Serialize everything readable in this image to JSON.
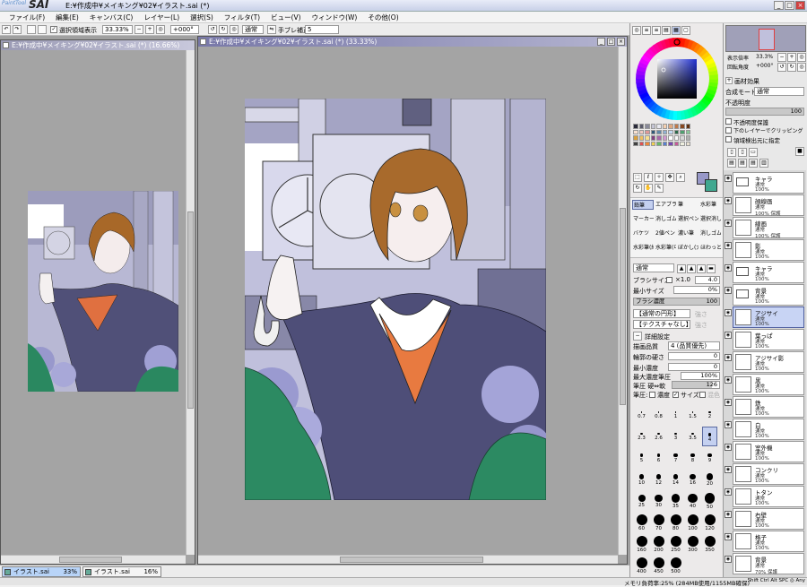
{
  "app": {
    "logo_small": "PaintTool",
    "logo_big": "SAI",
    "title": "E:¥作成中¥メイキング¥02¥イラスト.sai (*)"
  },
  "menu": [
    "ファイル(F)",
    "編集(E)",
    "キャンバス(C)",
    "レイヤー(L)",
    "選択(S)",
    "フィルタ(T)",
    "ビュー(V)",
    "ウィンドウ(W)",
    "その他(O)"
  ],
  "toolbar": {
    "selection_label": "選択領域表示",
    "zoom": "33.33%",
    "rotation": "+000°",
    "blend": "通常",
    "stabilizer_label": "手ブレ補正",
    "stabilizer_value": "5"
  },
  "documents": [
    {
      "title": "E:¥作成中¥メイキング¥02¥イラスト.sai (*) (16.66%)",
      "active": false
    },
    {
      "title": "E:¥作成中¥メイキング¥02¥イラスト.sai (*) (33.33%)",
      "active": true
    }
  ],
  "tasks": [
    {
      "name": "イラスト.sai",
      "zoom": "33%"
    },
    {
      "name": "イラスト.sai",
      "zoom": "16%"
    }
  ],
  "status": {
    "memory": "メモリ負荷率:25% (284MB使用/1155MB確保)",
    "keys": "Shift Ctrl Alt SPC ◎ Any"
  },
  "color": {
    "hue_ring": "#ff0000",
    "sv_base": "#2030d0",
    "primary": "#9898c8",
    "secondary": "#40a890"
  },
  "palette": [
    "#2a2a3a",
    "#5a5a6a",
    "#8a8a9a",
    "#c4c4d4",
    "#e8e8f0",
    "#f4d0b0",
    "#e0a880",
    "#c07848",
    "#884820",
    "#603010",
    "#f8e0d0",
    "#f0c8c0",
    "#e09898",
    "#305878",
    "#6088a8",
    "#90b0d0",
    "#c0d8f0",
    "#2a6848",
    "#50a070",
    "#88c898",
    "#d8a040",
    "#f0c060",
    "#f8e090",
    "#804080",
    "#a868a8",
    "#d098d0",
    "#ffffff",
    "#f8f8f8",
    "#d8d8d8",
    "#b0b0b0",
    "#404040",
    "#e05050",
    "#f08838",
    "#f0d050",
    "#68b868",
    "#5880d0",
    "#7848b0",
    "#c85898",
    "#f0f0e0",
    "#e8e0d0"
  ],
  "tools": [
    [
      "鉛筆",
      "エアブラシ",
      "筆",
      "水彩筆"
    ],
    [
      "マーカー",
      "消しゴム",
      "選択ペン",
      "選択消し"
    ],
    [
      "バケツ",
      "2値ペン",
      "濃い筆",
      "消しゴム"
    ],
    [
      "水彩筆(細)",
      "水彩筆(中)",
      "ぼかし(大)",
      "ほわっと"
    ]
  ],
  "brush": {
    "blend": "通常",
    "size_label": "ブラシサイズ",
    "size_mult": "×1.0",
    "size_value": "4.0",
    "min_size_label": "最小サイズ",
    "min_size_value": "0%",
    "min_size_fill": 0.0,
    "density_label": "ブラシ濃度",
    "density_value": "100",
    "density_fill": 1.0,
    "paper": "【通常の円形】",
    "paper_val": "強さ",
    "texture": "【テクスチャなし】",
    "texture_val": "強さ",
    "detail_label": "詳細設定",
    "quality_label": "描画品質",
    "quality_value": "4 (品質優先)",
    "edge_label": "輪郭の硬さ",
    "edge_value": "0",
    "min_density_label": "最小濃度",
    "min_density_value": "0",
    "max_pressure_label": "最大濃度筆圧",
    "max_pressure_value": "100%",
    "pressure_label": "筆圧 硬⇔軟",
    "pressure_value": "126",
    "pressure_opts": [
      "筆圧:",
      "濃度",
      "サイズ",
      "混色"
    ]
  },
  "brush_sizes": [
    "0.7",
    "0.8",
    "1",
    "1.5",
    "2",
    "2.3",
    "2.6",
    "3",
    "3.5",
    "4",
    "5",
    "6",
    "7",
    "8",
    "9",
    "10",
    "12",
    "14",
    "16",
    "20",
    "25",
    "30",
    "35",
    "40",
    "50",
    "60",
    "70",
    "80",
    "100",
    "120",
    "160",
    "200",
    "250",
    "300",
    "350",
    "400",
    "450",
    "500"
  ],
  "layer_props": {
    "preview_zoom_label": "表示倍率",
    "preview_zoom": "33.3%",
    "preview_rot_label": "回転角度",
    "preview_rot": "+000°",
    "effect_label": "画材効果",
    "mode_label": "合成モード",
    "mode": "通常",
    "opacity_label": "不透明度",
    "opacity": "100",
    "protect": "不透明度保護",
    "clip": "下のレイヤーでクリッピング",
    "source": "領域検出元に指定"
  },
  "layers": [
    {
      "name": "キャラ",
      "mode": "通常",
      "opacity": "100%",
      "folder": true,
      "selected": false
    },
    {
      "name": "顔線画",
      "mode": "通常",
      "opacity": "100% 保護",
      "folder": false,
      "selected": false
    },
    {
      "name": "線画",
      "mode": "通常",
      "opacity": "100% 保護",
      "folder": false,
      "selected": false
    },
    {
      "name": "影",
      "mode": "通常",
      "opacity": "100%",
      "folder": false,
      "selected": false
    },
    {
      "name": "キャラ",
      "mode": "通常",
      "opacity": "100%",
      "folder": true,
      "selected": false
    },
    {
      "name": "背景",
      "mode": "通常",
      "opacity": "100%",
      "folder": true,
      "selected": false
    },
    {
      "name": "アジサイ",
      "mode": "通常",
      "opacity": "100%",
      "folder": false,
      "selected": true
    },
    {
      "name": "葉っぱ",
      "mode": "通常",
      "opacity": "100%",
      "folder": false,
      "selected": false
    },
    {
      "name": "アジサイ影",
      "mode": "通常",
      "opacity": "100%",
      "folder": false,
      "selected": false
    },
    {
      "name": "黒",
      "mode": "通常",
      "opacity": "100%",
      "folder": false,
      "selected": false
    },
    {
      "name": "鉄",
      "mode": "通常",
      "opacity": "100%",
      "folder": false,
      "selected": false
    },
    {
      "name": "白",
      "mode": "通常",
      "opacity": "100%",
      "folder": false,
      "selected": false
    },
    {
      "name": "室外機",
      "mode": "通常",
      "opacity": "100%",
      "folder": false,
      "selected": false
    },
    {
      "name": "コンクリ",
      "mode": "通常",
      "opacity": "100%",
      "folder": false,
      "selected": false
    },
    {
      "name": "トタン",
      "mode": "通常",
      "opacity": "100%",
      "folder": false,
      "selected": false
    },
    {
      "name": "右壁",
      "mode": "通常",
      "opacity": "100%",
      "folder": false,
      "selected": false
    },
    {
      "name": "格子",
      "mode": "通常",
      "opacity": "100%",
      "folder": false,
      "selected": false
    },
    {
      "name": "背景",
      "mode": "通常",
      "opacity": "70% 保護",
      "folder": false,
      "selected": false
    }
  ]
}
